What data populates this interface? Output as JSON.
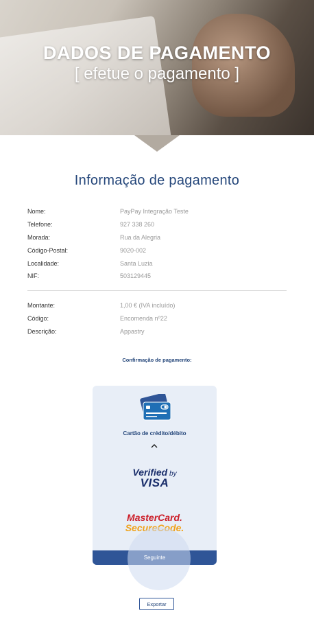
{
  "header": {
    "title": "DADOS DE PAGAMENTO",
    "subtitle": "[ efetue o pagamento ]"
  },
  "section_title": "Informação de pagamento",
  "customer": [
    {
      "label": "Nome:",
      "value": "PayPay Integração Teste"
    },
    {
      "label": "Telefone:",
      "value": "927 338 260"
    },
    {
      "label": "Morada:",
      "value": "Rua da Alegria"
    },
    {
      "label": "Código-Postal:",
      "value": "9020-002"
    },
    {
      "label": "Localidade:",
      "value": "Santa Luzia"
    },
    {
      "label": "NIF:",
      "value": "503129445"
    }
  ],
  "order": [
    {
      "label": "Montante:",
      "value": "1,00 € (IVA incluído)"
    },
    {
      "label": "Código:",
      "value": "Encomenda nº22"
    },
    {
      "label": "Descrição:",
      "value": "Appastry"
    }
  ],
  "confirmation_label": "Confirmação de pagamento:",
  "payment_method": {
    "icon": "credit-card-icon",
    "label": "Cartão de crédito/débito",
    "toggle_icon": "chevron-up-icon",
    "visa_line1": "Verified",
    "visa_by": "by",
    "visa_line2": "VISA",
    "mastercard_line1": "MasterCard.",
    "mastercard_line2": "SecureCode."
  },
  "next_button": "Seguinte",
  "export_button": "Exportar",
  "colors": {
    "brand": "#24467a",
    "button": "#2f5597",
    "panel": "#e8eef7"
  }
}
